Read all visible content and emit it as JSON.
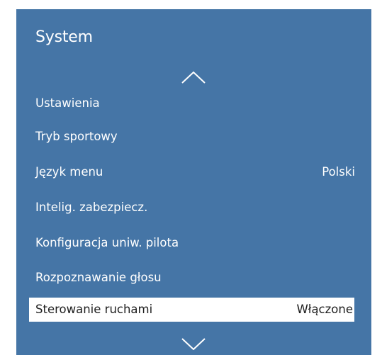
{
  "panel": {
    "title": "System",
    "background_color": "#4575a6",
    "selected_color": "#ffffff",
    "icons": {
      "scroll_up": "chevron-up-icon",
      "scroll_down": "chevron-down-icon"
    },
    "items": [
      {
        "label": "Ustawienia",
        "value": ""
      },
      {
        "label": "Tryb sportowy",
        "value": ""
      },
      {
        "label": "Język menu",
        "value": "Polski"
      },
      {
        "label": "Intelig. zabezpiecz.",
        "value": ""
      },
      {
        "label": "Konfiguracja uniw. pilota",
        "value": ""
      },
      {
        "label": "Rozpoznawanie głosu",
        "value": ""
      },
      {
        "label": "Sterowanie ruchami",
        "value": "Włączone",
        "selected": true
      }
    ]
  }
}
